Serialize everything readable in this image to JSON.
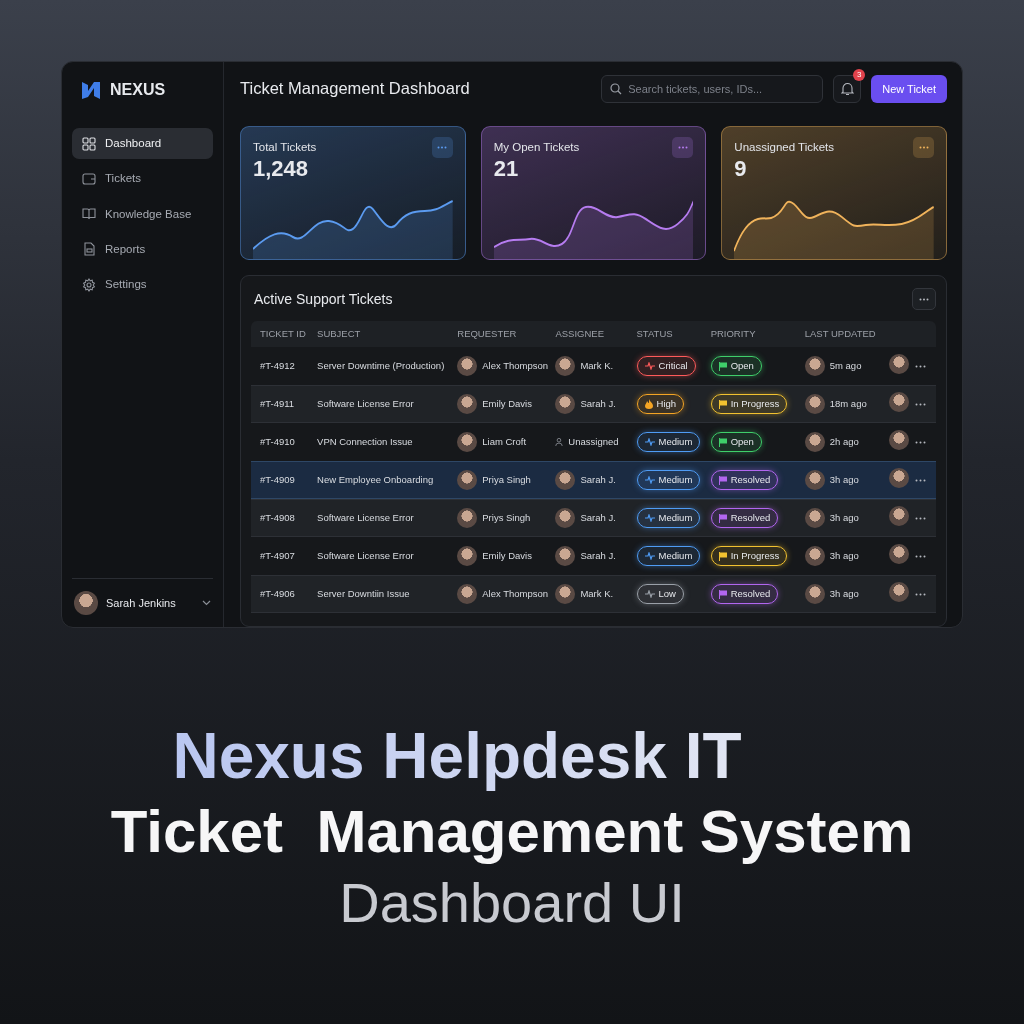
{
  "brand": {
    "name": "NEXUS"
  },
  "sidebar": {
    "items": [
      {
        "label": "Dashboard",
        "selected": true
      },
      {
        "label": "Tickets",
        "selected": false
      },
      {
        "label": "Knowledge Base",
        "selected": false
      },
      {
        "label": "Reports",
        "selected": false
      },
      {
        "label": "Settings",
        "selected": false
      }
    ],
    "user": {
      "name": "Sarah Jenkins"
    }
  },
  "header": {
    "title": "Ticket Management Dashboard",
    "search": {
      "placeholder": "Search tickets, users, IDs..."
    },
    "notifications": "3",
    "new_button": "New Ticket"
  },
  "stats": [
    {
      "title": "Total Tickets",
      "value": "1,248",
      "color": "#5b9bf0"
    },
    {
      "title": "My Open Tickets",
      "value": "21",
      "color": "#b67cf0"
    },
    {
      "title": "Unassigned Tickets",
      "value": "9",
      "color": "#f0b35b"
    }
  ],
  "table": {
    "title": "Active Support Tickets",
    "columns": [
      "TICKET ID",
      "SUBJECT",
      "REQUESTER",
      "ASSIGNEE",
      "STATUS",
      "PRIORITY",
      "LAST UPDATED"
    ],
    "rows": [
      {
        "id": "#T-4912",
        "subject": "Server Downtime (Production)",
        "requester": "Alex Thompson",
        "assignee": {
          "name": "Mark K.",
          "kind": "person"
        },
        "status": {
          "label": "Critical",
          "kind": "critical"
        },
        "priority": {
          "label": "Open",
          "kind": "open"
        },
        "updated": "5m ago",
        "raised": false,
        "selected": false
      },
      {
        "id": "#T-4911",
        "subject": "Software License Error",
        "requester": "Emily Davis",
        "assignee": {
          "name": "Sarah J.",
          "kind": "person"
        },
        "status": {
          "label": "High",
          "kind": "high"
        },
        "priority": {
          "label": "In Progress",
          "kind": "progress"
        },
        "updated": "18m ago",
        "raised": true,
        "selected": false
      },
      {
        "id": "#T-4910",
        "subject": "VPN Connection Issue",
        "requester": "Liam Croft",
        "assignee": {
          "name": "Unassigned",
          "kind": "unassigned"
        },
        "status": {
          "label": "Medium",
          "kind": "medium"
        },
        "priority": {
          "label": "Open",
          "kind": "open"
        },
        "updated": "2h ago",
        "raised": false,
        "selected": false
      },
      {
        "id": "#T-4909",
        "subject": "New Employee Onboarding",
        "requester": "Priya Singh",
        "assignee": {
          "name": "Sarah J.",
          "kind": "person"
        },
        "status": {
          "label": "Medium",
          "kind": "medium"
        },
        "priority": {
          "label": "Resolved",
          "kind": "resolved"
        },
        "updated": "3h ago",
        "raised": false,
        "selected": true
      },
      {
        "id": "#T-4908",
        "subject": "Software License Error",
        "requester": "Priys Singh",
        "assignee": {
          "name": "Sarah J.",
          "kind": "person"
        },
        "status": {
          "label": "Medium",
          "kind": "medium"
        },
        "priority": {
          "label": "Resolved",
          "kind": "resolved"
        },
        "updated": "3h ago",
        "raised": true,
        "selected": false
      },
      {
        "id": "#T-4907",
        "subject": "Software License Error",
        "requester": "Emily Davis",
        "assignee": {
          "name": "Sarah J.",
          "kind": "person"
        },
        "status": {
          "label": "Medium",
          "kind": "medium"
        },
        "priority": {
          "label": "In Progress",
          "kind": "progress"
        },
        "updated": "3h ago",
        "raised": false,
        "selected": false
      },
      {
        "id": "#T-4906",
        "subject": "Server Downtiin Issue",
        "requester": "Alex Thompson",
        "assignee": {
          "name": "Mark K.",
          "kind": "person"
        },
        "status": {
          "label": "Low",
          "kind": "low"
        },
        "priority": {
          "label": "Resolved",
          "kind": "resolved"
        },
        "updated": "3h ago",
        "raised": true,
        "selected": false
      }
    ]
  },
  "headline": {
    "line_1": "Nexus Helpdesk IT",
    "line_2": "Ticket  Management System",
    "line_3": "Dashboard UI"
  }
}
